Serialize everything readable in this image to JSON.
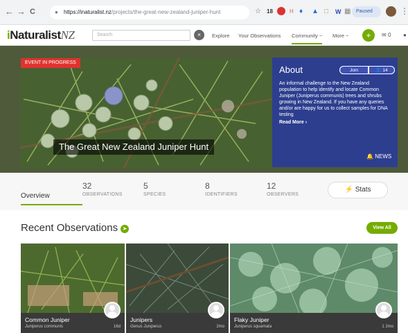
{
  "browser": {
    "back": "←",
    "forward": "→",
    "reload": "C",
    "url_host": "https://inaturalist.nz",
    "url_path": "/projects/the-great-new-zealand-juniper-hunt",
    "badge_count": "18",
    "paused_label": "Paused"
  },
  "header": {
    "logo_i": "i",
    "logo_main": "Naturalist",
    "logo_suffix": "NZ",
    "search_placeholder": "Search",
    "nav": [
      "Explore",
      "Your Observations",
      "Community ~",
      "More ~"
    ],
    "mail_count": "0"
  },
  "hero": {
    "event_tag": "EVENT IN PROGRESS",
    "title": "The Great New Zealand Juniper Hunt",
    "about_heading": "About",
    "join_label": "Join",
    "member_count": "14",
    "description": "An informal challenge to the New Zealand population to help identify and locate Common Juniper (Juniperus communis) trees and shrubs growing in New Zealand. If you have any queries and/or are happy for us to collect samples for DNA testing",
    "read_more": "Read More ›",
    "news_label": "NEWS"
  },
  "stats": {
    "overview_tab": "Overview",
    "items": [
      {
        "num": "32",
        "label": "OBSERVATIONS"
      },
      {
        "num": "5",
        "label": "SPECIES"
      },
      {
        "num": "8",
        "label": "IDENTIFIERS"
      },
      {
        "num": "12",
        "label": "OBSERVERS"
      }
    ],
    "stats_button": "Stats"
  },
  "recent": {
    "title": "Recent Observations",
    "view_all": "View All",
    "cards": [
      {
        "name": "Common Juniper",
        "sci": "Juniperus communis",
        "age": "16d"
      },
      {
        "name": "Junipers",
        "sci": "Genus Juniperus",
        "age": "2mo"
      },
      {
        "name": "Flaky Juniper",
        "sci": "Juniperus squamata",
        "age": "1  2mo"
      }
    ]
  }
}
